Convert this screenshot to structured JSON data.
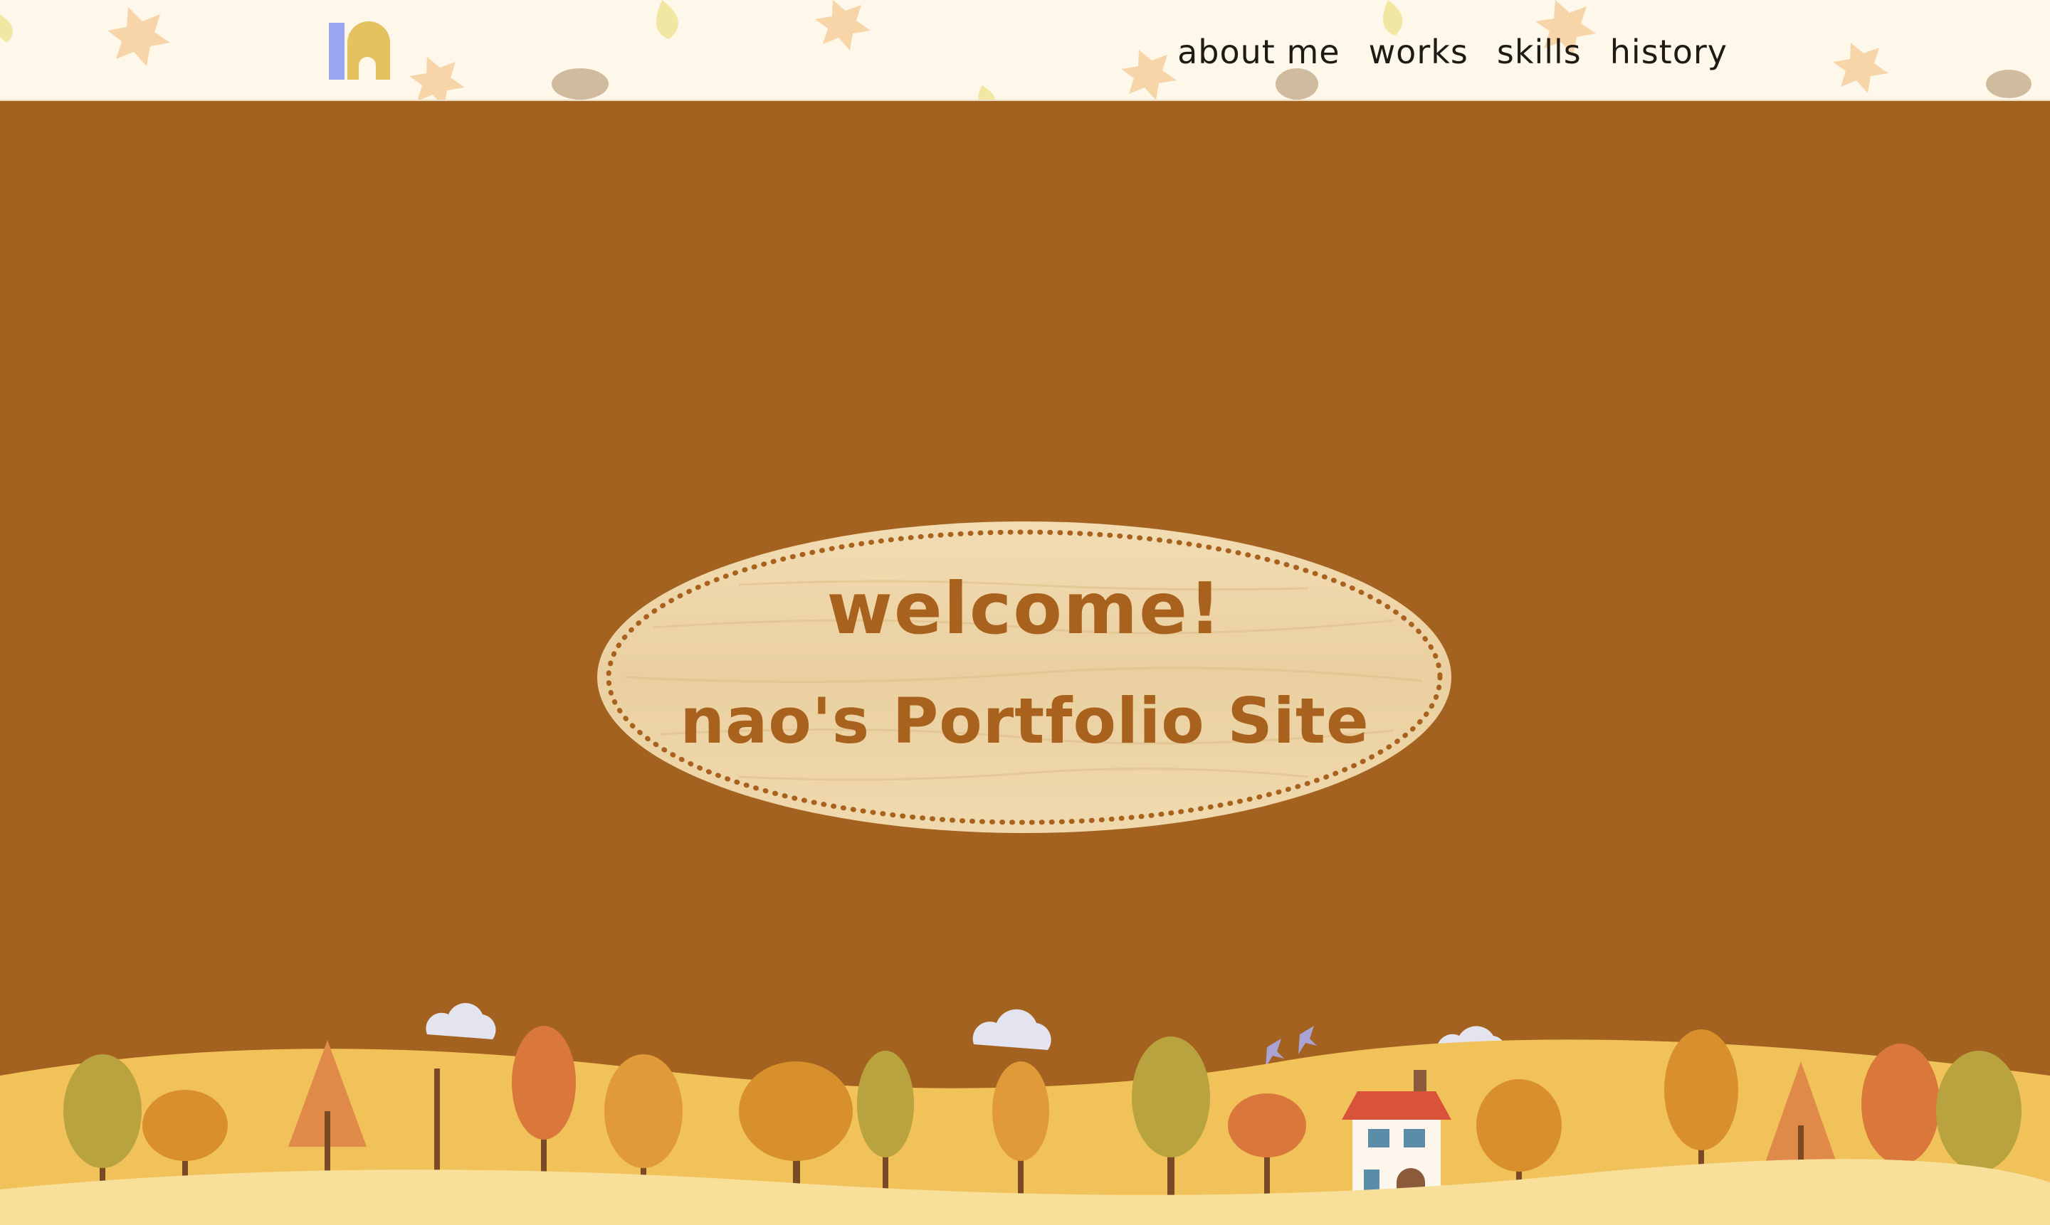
{
  "header": {
    "logo_name": "n-logo-icon",
    "nav": [
      {
        "label": "about me"
      },
      {
        "label": "works"
      },
      {
        "label": "skills"
      },
      {
        "label": "history"
      }
    ]
  },
  "hero": {
    "welcome": "welcome!",
    "subtitle": "nao's Portfolio Site"
  },
  "colors": {
    "hero_bg": "#a3621f",
    "header_bg": "#fdf8ea",
    "sign_wood": "#efd7ac",
    "sign_text": "#a8621e",
    "logo_blue": "#9aa6f0",
    "logo_gold": "#e3c25f"
  }
}
